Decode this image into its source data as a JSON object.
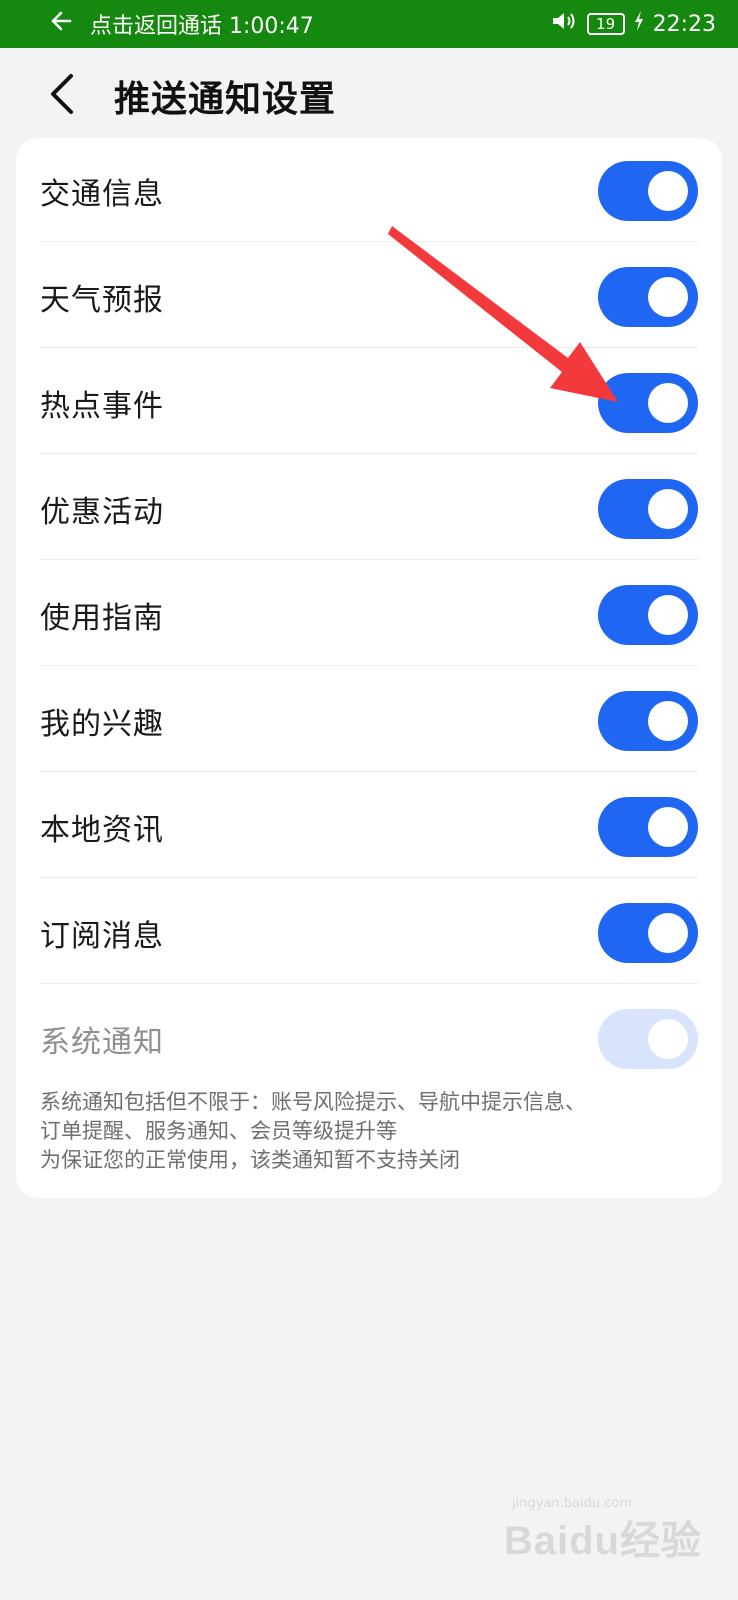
{
  "status_bar": {
    "call_text": "点击返回通话 1:00:47",
    "battery": "19",
    "time": "22:23"
  },
  "header": {
    "title": "推送通知设置"
  },
  "settings": [
    {
      "label": "交通信息",
      "enabled": true
    },
    {
      "label": "天气预报",
      "enabled": true
    },
    {
      "label": "热点事件",
      "enabled": true
    },
    {
      "label": "优惠活动",
      "enabled": true
    },
    {
      "label": "使用指南",
      "enabled": true
    },
    {
      "label": "我的兴趣",
      "enabled": true
    },
    {
      "label": "本地资讯",
      "enabled": true
    },
    {
      "label": "订阅消息",
      "enabled": true
    },
    {
      "label": "系统通知",
      "enabled": true,
      "disabled": true
    }
  ],
  "note": {
    "line1": "系统通知包括但不限于：账号风险提示、导航中提示信息、",
    "line2": "订单提醒、服务通知、会员等级提升等",
    "line3": "为保证您的正常使用，该类通知暂不支持关闭"
  },
  "watermark": {
    "logo": "Baidu经验",
    "url": "jingyan.baidu.com"
  },
  "colors": {
    "status_bar": "#15890f",
    "toggle_on": "#1f66f2",
    "toggle_disabled": "#d8e4fb",
    "annotation_arrow": "#f2393b"
  }
}
